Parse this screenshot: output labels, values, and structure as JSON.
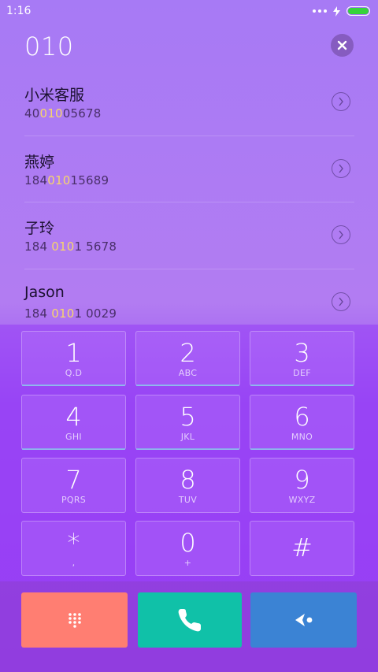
{
  "status": {
    "time": "1:16"
  },
  "search": {
    "query": "010"
  },
  "results": [
    {
      "name": "小米客服",
      "num_pre": "40",
      "num_hl": "010",
      "num_post": "05678"
    },
    {
      "name": "燕婷",
      "num_pre": "184",
      "num_hl": "010",
      "num_post": "15689"
    },
    {
      "name": "子玲",
      "num_pre": "184 ",
      "num_hl": "010",
      "num_post": "1 5678"
    },
    {
      "name": "Jason",
      "num_pre": "184 ",
      "num_hl": "010",
      "num_post": "1 0029"
    }
  ],
  "keys": [
    {
      "digit": "1",
      "letters": "Q.D"
    },
    {
      "digit": "2",
      "letters": "ABC"
    },
    {
      "digit": "3",
      "letters": "DEF"
    },
    {
      "digit": "4",
      "letters": "GHI"
    },
    {
      "digit": "5",
      "letters": "JKL"
    },
    {
      "digit": "6",
      "letters": "MNO"
    },
    {
      "digit": "7",
      "letters": "PQRS"
    },
    {
      "digit": "8",
      "letters": "TUV"
    },
    {
      "digit": "9",
      "letters": "WXYZ"
    },
    {
      "digit": "*",
      "letters": ","
    },
    {
      "digit": "0",
      "letters": "+"
    },
    {
      "digit": "#",
      "letters": ""
    }
  ],
  "colors": {
    "highlight": "#f7d56b",
    "dialpad_button": "#ff7e72",
    "call_button": "#10c1a8",
    "backspace_button": "#3b83d4",
    "battery": "#37d33b"
  },
  "icons": {
    "clear": "close-icon",
    "result_arrow": "chevron-right-circle-icon",
    "dialpad": "dialpad-icon",
    "call": "phone-icon",
    "backspace": "backspace-icon"
  }
}
